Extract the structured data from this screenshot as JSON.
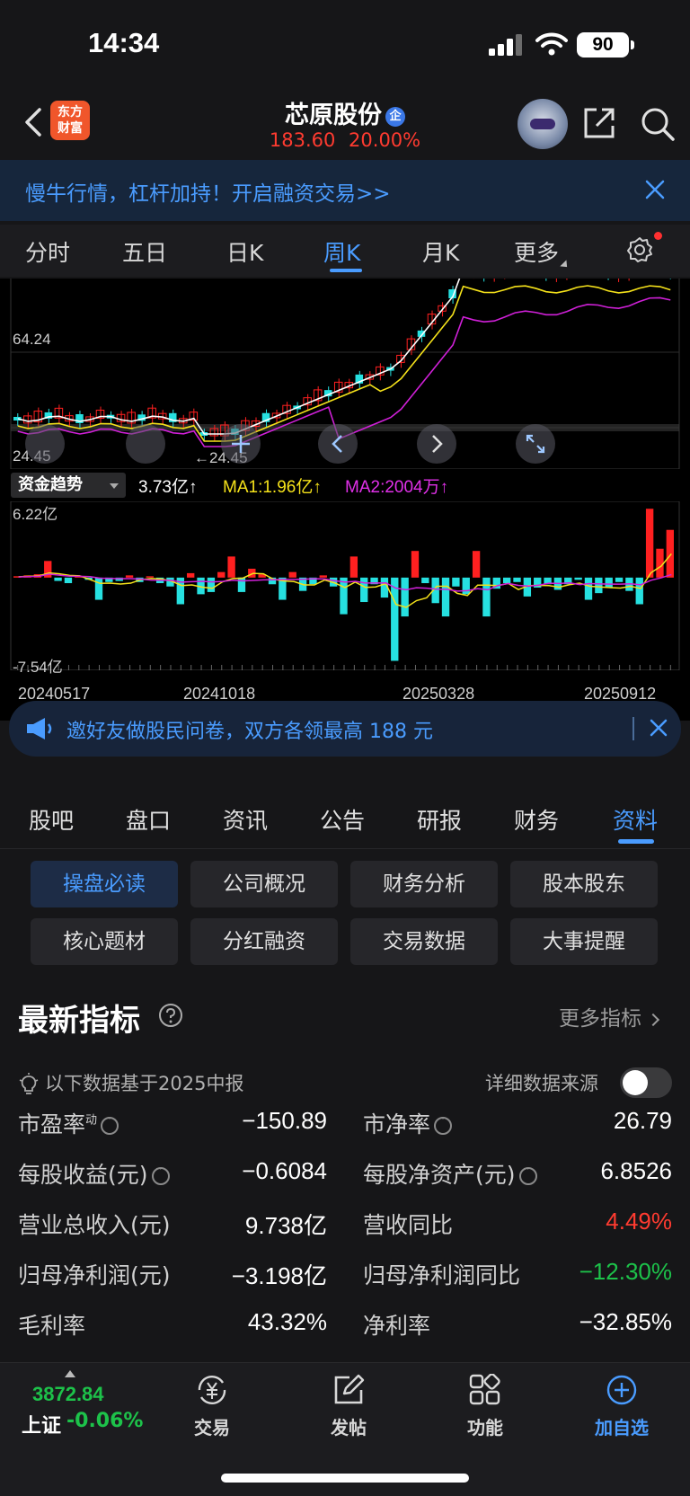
{
  "status": {
    "time": "14:34",
    "battery": "90"
  },
  "header": {
    "logo_line1": "东方",
    "logo_line2": "财富",
    "stock_name": "芯原股份",
    "badge": "企",
    "price": "183.60",
    "change_pct": "20.00%"
  },
  "promo": {
    "text": "慢牛行情，杠杆加持！开启融资交易>>"
  },
  "period_tabs": [
    "分时",
    "五日",
    "日K",
    "周K",
    "月K",
    "更多"
  ],
  "active_period": "周K",
  "chart": {
    "price_label_high": "64.24",
    "price_label_low": "24.45",
    "price_label_low_marker": "←24.45",
    "fund_selector": "资金趋势",
    "fund_value": "3.73亿↑",
    "fund_ma1": "MA1:1.96亿↑",
    "fund_ma2": "MA2:2004万↑",
    "fund_max": "6.22亿",
    "fund_min": "-7.54亿",
    "dates": [
      "20240517",
      "20241018",
      "20250328",
      "20250912"
    ],
    "colors": {
      "up": "#ff2020",
      "down": "#26e0e0",
      "ma_white": "#ffffff",
      "ma_yellow": "#f5e21a",
      "ma_magenta": "#d020d8"
    }
  },
  "chart_data": {
    "type": "bar",
    "title": "资金趋势",
    "ylim": [
      -7.54,
      6.22
    ],
    "series": [
      {
        "name": "资金趋势",
        "values": [
          0.1,
          0.2,
          0.3,
          1.5,
          -0.3,
          -0.5,
          0.1,
          -0.2,
          -2,
          -0.4,
          -0.3,
          0.2,
          -0.4,
          0.1,
          -0.5,
          -0.8,
          -2.4,
          0.4,
          -1.5,
          -1.3,
          0.5,
          1.9,
          -1.3,
          0.8,
          0.3,
          -0.6,
          -2.0,
          0.5,
          -1.2,
          -0.6,
          0.2,
          -0.8,
          -3.3,
          1.9,
          -2.2,
          -0.6,
          -1.8,
          -7.5,
          -3.5,
          2.4,
          -0.5,
          -2.3,
          -3.5,
          -0.8,
          -1.5,
          2.4,
          -3.5,
          -1.0,
          -0.5,
          -0.4,
          -1.7,
          -0.9,
          -0.6,
          -1.1,
          -0.6,
          -0.2,
          -2.0,
          -1.4,
          -0.9,
          -0.4,
          -1.2,
          -2.4,
          6.2,
          2.6,
          4.3
        ]
      }
    ]
  },
  "invite": {
    "text": "邀好友做股民问卷，双方各领最高 188 元"
  },
  "section_tabs": [
    "股吧",
    "盘口",
    "资讯",
    "公告",
    "研报",
    "财务",
    "资料"
  ],
  "active_section": "资料",
  "sub_buttons": [
    "操盘必读",
    "公司概况",
    "财务分析",
    "股本股东",
    "核心题材",
    "分红融资",
    "交易数据",
    "大事提醒"
  ],
  "indicators": {
    "title": "最新指标",
    "more": "更多指标",
    "basis": "以下数据基于2025中报",
    "source_label": "详细数据来源",
    "rows": [
      {
        "l1": "市盈率",
        "sup": "动",
        "v1": "−150.89",
        "l2": "市净率",
        "v2": "26.79"
      },
      {
        "l1": "每股收益(元)",
        "v1": "−0.6084",
        "l2": "每股净资产(元)",
        "v2": "6.8526"
      },
      {
        "l1": "营业总收入(元)",
        "v1": "9.738亿",
        "l2": "营收同比",
        "v2": "4.49%"
      },
      {
        "l1": "归母净利润(元)",
        "v1": "−3.198亿",
        "l2": "归母净利润同比",
        "v2": "−12.30%"
      },
      {
        "l1": "毛利率",
        "v1": "43.32%",
        "l2": "净利率",
        "v2": "−32.85%"
      }
    ]
  },
  "bottom_bar": {
    "index_value": "3872.84",
    "index_name": "上证",
    "index_change": "-0.06%",
    "items": [
      "交易",
      "发帖",
      "功能",
      "加自选"
    ]
  }
}
